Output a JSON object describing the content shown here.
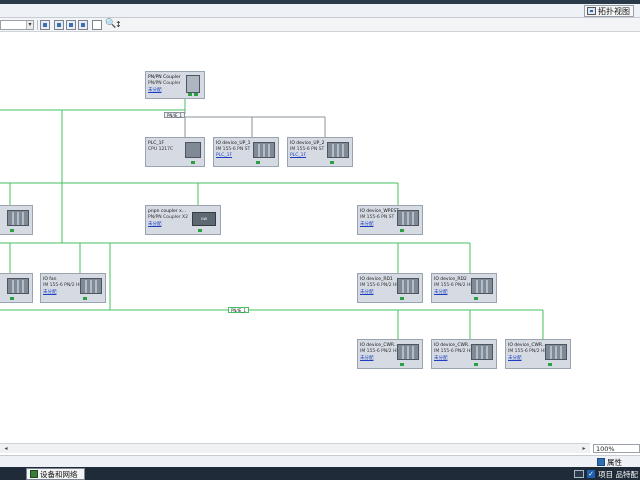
{
  "window": {
    "topology_view_label": "拓扑视图"
  },
  "toolbar": {
    "combo_value": "",
    "icons": [
      "network-view-icon",
      "connections-icon",
      "highlight-icon",
      "grid-icon",
      "page-icon",
      "zoom-icon",
      "pointer-icon"
    ]
  },
  "networks": {
    "pn_ie_1_top": "PN/IE_1",
    "pn_ie_1_mid": "PN/IE_1"
  },
  "devices": {
    "pnpn_coupler": {
      "name": "PN/PN Coupler",
      "type": "PN/PN Coupler",
      "link": "未分配"
    },
    "plc_1": {
      "name": "PLC_1F",
      "type": "CPU 1217C",
      "link": ""
    },
    "io_up1": {
      "name": "IO device_UP_1",
      "type": "IM 155-6 PN ST",
      "link": "PLC_1F"
    },
    "io_up2": {
      "name": "IO device_UP_2",
      "type": "IM 155-6 PN ST",
      "link": "PLC_1F"
    },
    "left_partial_1": {
      "name": "",
      "type": "",
      "link": ""
    },
    "pnpn_coupler_x2": {
      "name": "pnpn coupler x...",
      "type": "PN/PN Coupler X2",
      "link": "未分配"
    },
    "io_wpest": {
      "name": "IO device_WPEST",
      "type": "IM 155-6 PN ST",
      "link": "未分配"
    },
    "left_partial_2": {
      "name": "",
      "type": "",
      "link": ""
    },
    "io_fan": {
      "name": "IO fan",
      "type": "IM 155-6 PN/2 HF",
      "link": "未分配"
    },
    "io_rd1": {
      "name": "IO device_RD1",
      "type": "IM 155-6 PN/2 HF",
      "link": "未分配"
    },
    "io_rd2": {
      "name": "IO device_RD2",
      "type": "IM 155-6 PN/2 HF",
      "link": "未分配"
    },
    "io_cwr1": {
      "name": "IO device_CWR...",
      "type": "IM 155-6 PN/2 HF",
      "link": "未分配"
    },
    "io_cwr2": {
      "name": "IO device_CWR...",
      "type": "IM 155-6 PN/2 HF",
      "link": "未分配"
    },
    "io_cwr3": {
      "name": "IO device_CWR...",
      "type": "IM 155-6 PN/2 HF",
      "link": "未分配"
    }
  },
  "footer": {
    "zoom": "100%",
    "properties_label": "属性",
    "devnet_tab": "设备和网络",
    "project_info": "项目 品特配"
  },
  "colors": {
    "network_green": "#44c060",
    "device_bg": "#d6dbe3",
    "status_dark": "#1f2b38"
  }
}
